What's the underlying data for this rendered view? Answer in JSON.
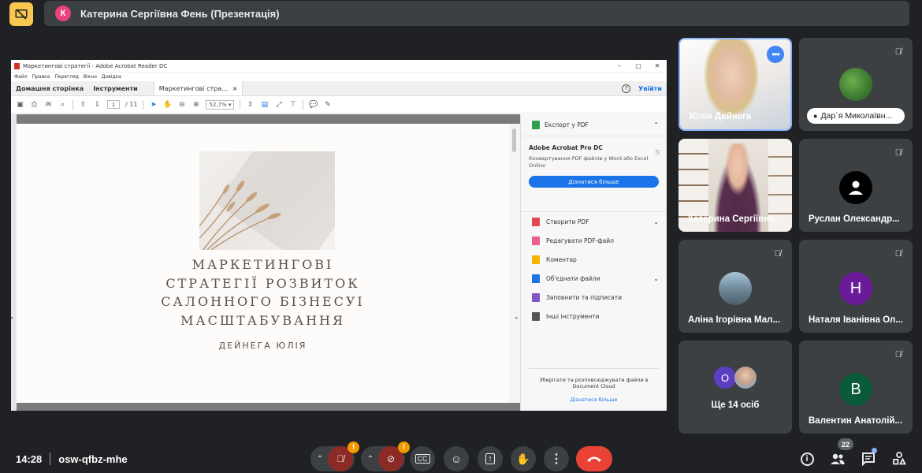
{
  "presenter": {
    "initial": "К",
    "label": "Катерина Сергіївна Фень (Презентація)"
  },
  "acrobat": {
    "window_title": "Маркетингові стратегії - Adobe Acrobat Reader DC",
    "window_controls": [
      "–",
      "▢",
      "✕"
    ],
    "menu": [
      "Файл",
      "Правка",
      "Перегляд",
      "Вікно",
      "Довідка"
    ],
    "tabs": {
      "home": "Домашня сторінка",
      "tools": "Інструменти",
      "doc": "Маркетингові стра...",
      "doc_close": "×"
    },
    "help": "?",
    "login": "Увійти",
    "toolbar": {
      "page_current": "1",
      "page_total": "/ 11",
      "zoom": "52,7%"
    },
    "page": {
      "title_lines": [
        "МАРКЕТИНГОВІ",
        "СТРАТЕГІЇ РОЗВИТОК",
        "САЛОННОГО БІЗНЕСУІ",
        "МАСШТАБУВАННЯ"
      ],
      "author": "ДЕЙНЕГА ЮЛІЯ"
    },
    "right_pane": {
      "export": "Експорт у PDF",
      "promo_title": "Adobe Acrobat Pro DC",
      "promo_desc": "Конвертування PDF-файлів у Word або Excel Online",
      "promo_button": "Дізнатися більше",
      "items": [
        {
          "label": "Створити PDF",
          "color": "#e34850",
          "chevron": true
        },
        {
          "label": "Редагувати PDF-файл",
          "color": "#ec5d89",
          "chevron": false
        },
        {
          "label": "Коментар",
          "color": "#f4b400",
          "chevron": false
        },
        {
          "label": "Об'єднати файли",
          "color": "#1a73e8",
          "chevron": true
        },
        {
          "label": "Заповнити та підписати",
          "color": "#7e57c2",
          "chevron": false
        },
        {
          "label": "Інші інструменти",
          "color": "#555555",
          "chevron": false
        }
      ],
      "cloud_text": "Зберігати та розповсюджувати файли в Document Cloud",
      "cloud_link": "Дізнатися більше"
    }
  },
  "participants": [
    {
      "name": "Юлія Дейнега",
      "type": "video-a",
      "active": true
    },
    {
      "name": "Дар`я Миколаївн...",
      "type": "photo-pill",
      "muted": true
    },
    {
      "name": "Катерина Сергіївна...",
      "type": "video-b"
    },
    {
      "name": "Руслан Олександр...",
      "type": "avatar",
      "muted": true,
      "color": "#000000"
    },
    {
      "name": "Аліна Ігорівна Мал...",
      "type": "photo",
      "muted": true
    },
    {
      "name": "Наталя Іванівна Ол...",
      "type": "letter",
      "letter": "Н",
      "muted": true,
      "color": "#6a1b9a"
    },
    {
      "name": "Ще 14 осіб",
      "type": "others",
      "letter": "О"
    },
    {
      "name": "Валентин Анатолій...",
      "type": "letter",
      "letter": "В",
      "muted": true,
      "color": "#0b5a3c"
    }
  ],
  "bottom": {
    "time": "14:28",
    "meeting_code": "osw-qfbz-mhe",
    "warn": "!",
    "people_count": "22"
  },
  "colors": {
    "background": "#202124",
    "tile": "#3c4043",
    "end_call": "#ea4335",
    "accent": "#8ab4f8"
  }
}
